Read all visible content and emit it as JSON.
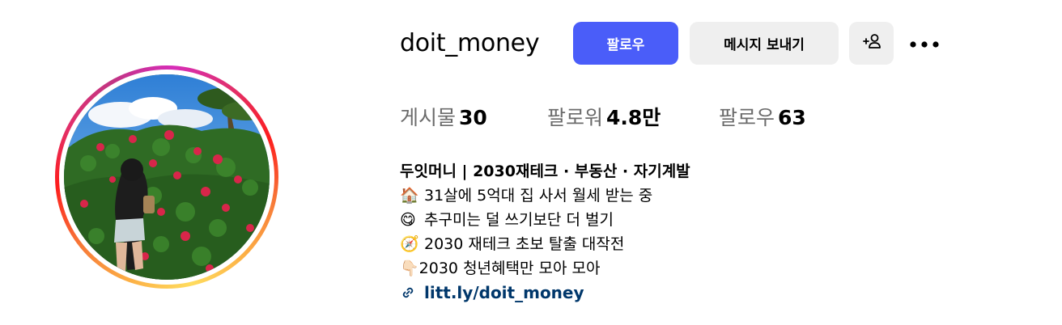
{
  "profile": {
    "username": "doit_money",
    "buttons": {
      "follow": "팔로우",
      "message": "메시지 보내기"
    },
    "stats": [
      {
        "label": "게시물",
        "value": "30"
      },
      {
        "label": "팔로워",
        "value": "4.8만"
      },
      {
        "label": "팔로우",
        "value": "63"
      }
    ],
    "bio": {
      "name": "두잇머니 | 2030재테크 · 부동산 · 자기계발",
      "lines": [
        {
          "emoji": "🏠",
          "text": "31살에 5억대 집 사서 월세 받는 중"
        },
        {
          "emoji": "😋",
          "text": "추구미는 덜 쓰기보단 더 벌기"
        },
        {
          "emoji": "🧭",
          "text": "2030 재테크 초보 탈출 대작전"
        },
        {
          "emoji": "👇🏻",
          "text": "2030 청년혜택만 모아 모아"
        }
      ],
      "link": "litt.ly/doit_money"
    },
    "icons": {
      "add_user": "add-user-icon",
      "more": "more-icon",
      "link": "link-icon"
    },
    "colors": {
      "follow_button": "#4a5df9",
      "secondary_button": "#efefef",
      "link_text": "#00376b",
      "stat_label": "#6b6b6b"
    }
  }
}
